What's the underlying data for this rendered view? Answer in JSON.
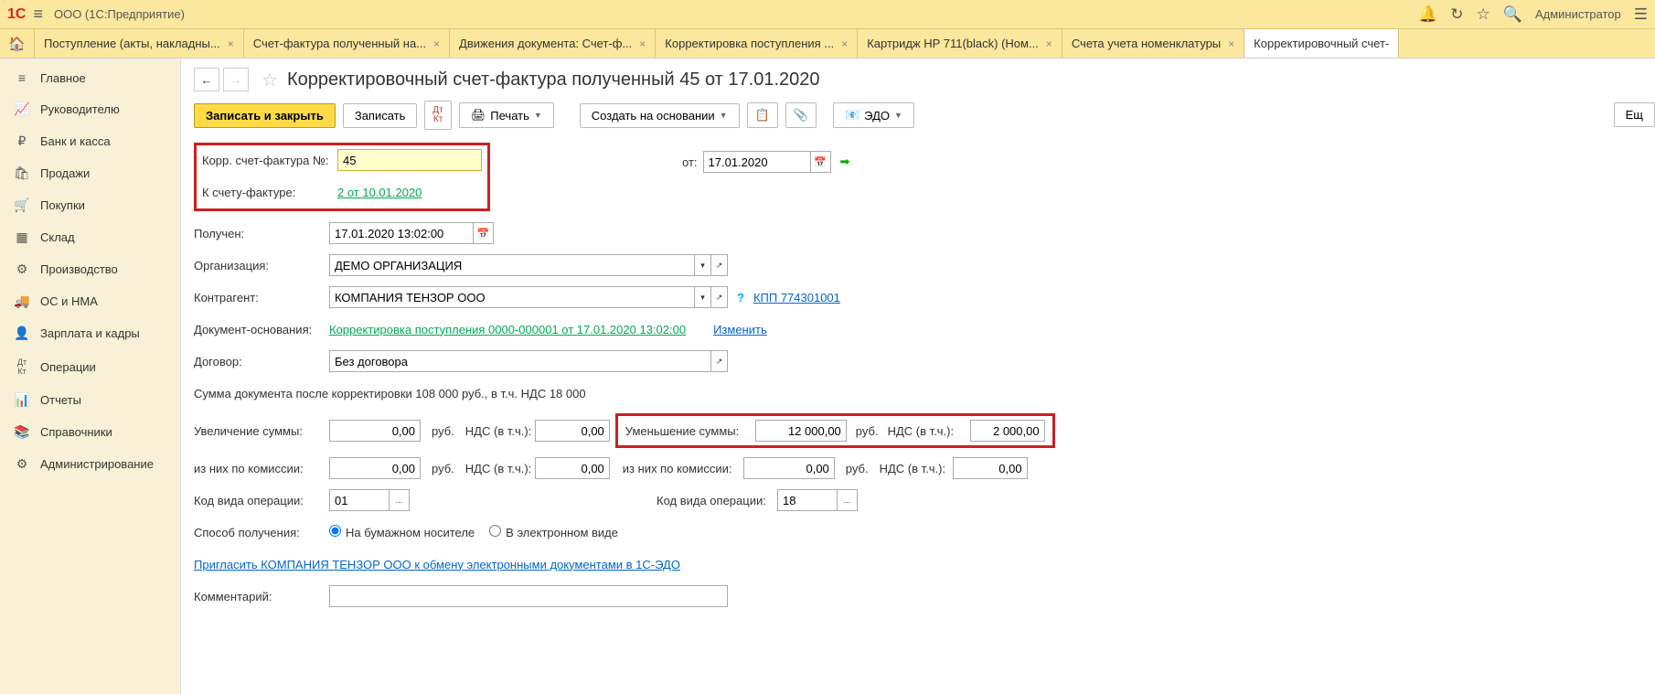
{
  "titlebar": {
    "title": "ООО (1С:Предприятие)",
    "user": "Администратор"
  },
  "tabs": [
    {
      "label": "Поступление (акты, накладны..."
    },
    {
      "label": "Счет-фактура полученный на..."
    },
    {
      "label": "Движения документа: Счет-ф..."
    },
    {
      "label": "Корректировка поступления ..."
    },
    {
      "label": "Картридж HP 711(black) (Ном..."
    },
    {
      "label": "Счета учета номенклатуры"
    },
    {
      "label": "Корректировочный счет-"
    }
  ],
  "sidebar": [
    {
      "icon": "≡",
      "label": "Главное"
    },
    {
      "icon": "📈",
      "label": "Руководителю"
    },
    {
      "icon": "₽",
      "label": "Банк и касса"
    },
    {
      "icon": "🛍",
      "label": "Продажи"
    },
    {
      "icon": "🛒",
      "label": "Покупки"
    },
    {
      "icon": "🏢",
      "label": "Склад"
    },
    {
      "icon": "🏭",
      "label": "Производство"
    },
    {
      "icon": "🚚",
      "label": "ОС и НМА"
    },
    {
      "icon": "👤",
      "label": "Зарплата и кадры"
    },
    {
      "icon": "Дт/Кт",
      "label": "Операции"
    },
    {
      "icon": "📊",
      "label": "Отчеты"
    },
    {
      "icon": "📚",
      "label": "Справочники"
    },
    {
      "icon": "⚙",
      "label": "Администрирование"
    }
  ],
  "doc": {
    "title": "Корректировочный счет-фактура полученный 45 от 17.01.2020",
    "save_close": "Записать и закрыть",
    "save": "Записать",
    "print": "Печать",
    "create_based": "Создать на основании",
    "edo": "ЭДО",
    "more": "Ещ"
  },
  "form": {
    "corr_num_label": "Корр. счет-фактура №:",
    "corr_num": "45",
    "from_label": "от:",
    "from_date": "17.01.2020",
    "to_invoice_label": "К счету-фактуре:",
    "to_invoice_link": "2 от 10.01.2020",
    "received_label": "Получен:",
    "received": "17.01.2020 13:02:00",
    "org_label": "Организация:",
    "org": "ДЕМО ОРГАНИЗАЦИЯ",
    "contractor_label": "Контрагент:",
    "contractor": "КОМПАНИЯ ТЕНЗОР ООО",
    "kpp": "КПП 774301001",
    "doc_base_label": "Документ-основания:",
    "doc_base_link": "Корректировка поступления 0000-000001 от 17.01.2020 13:02:00",
    "change": "Изменить",
    "contract_label": "Договор:",
    "contract": "Без договора",
    "sum_text": "Сумма документа после корректировки 108 000 руб., в т.ч. НДС 18 000",
    "increase_label": "Увеличение суммы:",
    "increase": "0,00",
    "vat_label": "НДС (в т.ч.):",
    "vat_inc": "0,00",
    "decrease_label": "Уменьшение суммы:",
    "decrease": "12 000,00",
    "vat_dec": "2 000,00",
    "rub": "руб.",
    "commission_label": "из них по комиссии:",
    "comm_inc": "0,00",
    "comm_vat_inc": "0,00",
    "comm_dec": "0,00",
    "comm_vat_dec": "0,00",
    "op_code_label": "Код вида операции:",
    "op_code1": "01",
    "op_code2": "18",
    "receive_method_label": "Способ получения:",
    "paper": "На бумажном носителе",
    "electronic": "В электронном виде",
    "invite_link": "Пригласить КОМПАНИЯ ТЕНЗОР ООО к обмену электронными документами в 1С-ЭДО",
    "comment_label": "Комментарий:"
  }
}
